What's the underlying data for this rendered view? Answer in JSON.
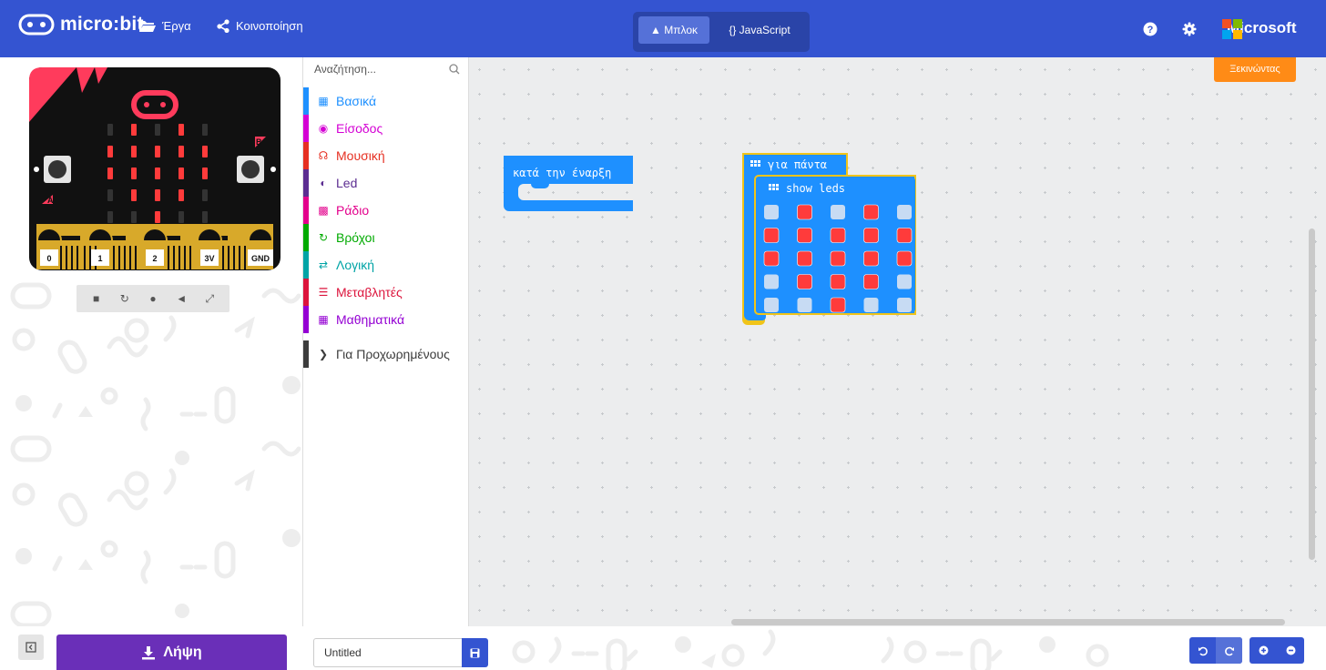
{
  "header": {
    "app_name": "micro:bit",
    "nav": {
      "projects_label": "Έργα",
      "share_label": "Κοινοποίηση"
    },
    "mode": {
      "blocks_label": "Μπλοκ",
      "javascript_label": "{} JavaScript",
      "active": "blocks"
    },
    "icons": [
      "help-icon",
      "settings-icon"
    ],
    "brand": "Microsoft"
  },
  "simulator": {
    "pin_labels": [
      "0",
      "1",
      "2",
      "3V",
      "GND"
    ],
    "button_labels": [
      "A",
      "B"
    ],
    "led_matrix": [
      [
        0,
        1,
        0,
        1,
        0
      ],
      [
        1,
        1,
        1,
        1,
        1
      ],
      [
        1,
        1,
        1,
        1,
        1
      ],
      [
        0,
        1,
        1,
        1,
        0
      ],
      [
        0,
        0,
        1,
        0,
        0
      ]
    ],
    "controls": [
      "stop-icon",
      "restart-icon",
      "slowmo-icon",
      "mute-icon",
      "fullscreen-icon"
    ]
  },
  "toolbox": {
    "search_placeholder": "Αναζήτηση...",
    "categories": [
      {
        "label": "Βασικά",
        "color": "#1e90ff",
        "icon": "grid-icon"
      },
      {
        "label": "Είσοδος",
        "color": "#d400d4",
        "icon": "target-icon"
      },
      {
        "label": "Μουσική",
        "color": "#e63022",
        "icon": "headphones-icon"
      },
      {
        "label": "Led",
        "color": "#5c2d91",
        "icon": "toggle-icon"
      },
      {
        "label": "Ράδιο",
        "color": "#e3008c",
        "icon": "signal-icon"
      },
      {
        "label": "Βρόχοι",
        "color": "#00aa00",
        "icon": "loop-icon"
      },
      {
        "label": "Λογική",
        "color": "#00a4a6",
        "icon": "shuffle-icon"
      },
      {
        "label": "Μεταβλητές",
        "color": "#dc143c",
        "icon": "list-icon"
      },
      {
        "label": "Μαθηματικά",
        "color": "#9400d3",
        "icon": "calculator-icon"
      }
    ],
    "advanced_label": "Για Προχωρημένους",
    "advanced_color": "#3c3c3c"
  },
  "workspace": {
    "start_button": "Ξεκινώντας",
    "on_start_label": "κατά την έναρξη",
    "forever_label": "για πάντα",
    "show_leds_label": "show leds",
    "show_leds_matrix": [
      [
        0,
        1,
        0,
        1,
        0
      ],
      [
        1,
        1,
        1,
        1,
        1
      ],
      [
        1,
        1,
        1,
        1,
        1
      ],
      [
        0,
        1,
        1,
        1,
        0
      ],
      [
        0,
        0,
        1,
        0,
        0
      ]
    ]
  },
  "footer": {
    "download_label": "Λήψη",
    "project_name": "Untitled",
    "icons": [
      "collapse-icon",
      "download-icon",
      "save-icon",
      "undo-icon",
      "redo-icon",
      "zoom-in-icon",
      "zoom-out-icon"
    ]
  },
  "colors": {
    "topbar": "#3454d1",
    "download": "#6a2fb8",
    "start_button": "#ff8b16",
    "block_blue": "#1e90ff",
    "block_outline": "#f0c419",
    "led_on": "#ff3b3b"
  }
}
